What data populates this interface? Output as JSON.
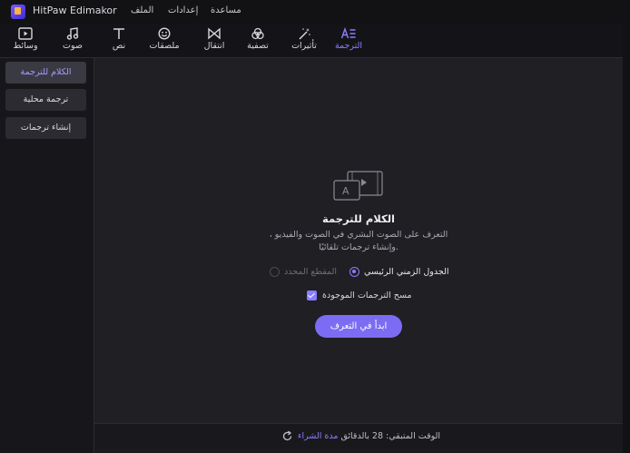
{
  "app": {
    "title": "HitPaw Edimakor"
  },
  "menu": {
    "help": "مساعدة",
    "settings": "إعدادات",
    "file": "الملف"
  },
  "toolbar": {
    "items": [
      {
        "label": "وسائط",
        "icon": "media-icon"
      },
      {
        "label": "صوت",
        "icon": "music-note-icon"
      },
      {
        "label": "نص",
        "icon": "text-icon"
      },
      {
        "label": "ملصقات",
        "icon": "sticker-icon"
      },
      {
        "label": "انتقال",
        "icon": "transition-icon"
      },
      {
        "label": "تصفية",
        "icon": "filter-icon"
      },
      {
        "label": "تأثيرات",
        "icon": "effects-wand-icon"
      },
      {
        "label": "الترجمة",
        "icon": "subtitle-icon",
        "active": true
      }
    ]
  },
  "sidebar": {
    "items": [
      {
        "label": "الكلام للترجمة",
        "active": true
      },
      {
        "label": "ترجمة محلية"
      },
      {
        "label": "إنشاء ترجمات"
      }
    ]
  },
  "panel": {
    "heading": "الكلام للترجمة",
    "description": "التعرف على الصوت البشري في الصوت والفيديو ، وإنشاء ترجمات تلقائيًا.",
    "radio_main": "الجدول الزمني الرئيسي",
    "radio_selected_clip": "المقطع المحدد",
    "checkbox_label": "مسح الترجمات الموجودة",
    "checkbox_checked": true,
    "start_button": "ابدأ في التعرف"
  },
  "footer": {
    "buy_link": "مدة الشراء",
    "remaining_time": "الوقت المتبقي: 28 بالدقائق"
  },
  "colors": {
    "accent": "#8a7dff",
    "button": "#7c6cf4",
    "background": "#1f1f24"
  }
}
